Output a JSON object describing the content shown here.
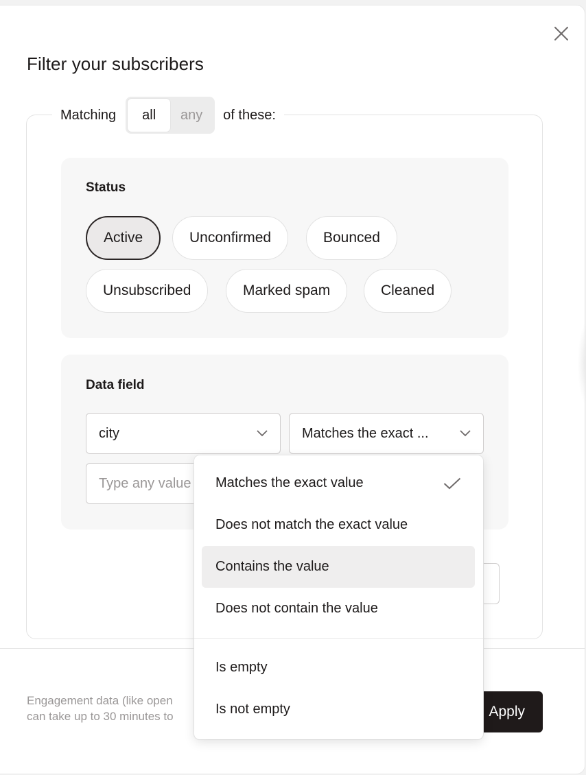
{
  "dialog": {
    "title": "Filter your subscribers",
    "close_icon": "close-icon"
  },
  "match": {
    "prefix": "Matching",
    "options": [
      "all",
      "any"
    ],
    "selected": "all",
    "suffix": "of these:"
  },
  "status": {
    "title": "Status",
    "chips": [
      "Active",
      "Unconfirmed",
      "Bounced",
      "Unsubscribed",
      "Marked spam",
      "Cleaned"
    ],
    "selected": "Active"
  },
  "data_field": {
    "title": "Data field",
    "field_value": "city",
    "operator_value": "Matches the exact ...",
    "value_placeholder": "Type any value"
  },
  "operator_menu": {
    "options": [
      "Matches the exact value",
      "Does not match the exact value",
      "Contains the value",
      "Does not contain the value",
      "Is empty",
      "Is not empty"
    ],
    "checked": "Matches the exact value",
    "hovered": "Contains the value"
  },
  "footer": {
    "note_line1": "Engagement data (like open",
    "note_line2": "can take up to 30 minutes to",
    "apply_label": "Apply"
  },
  "colors": {
    "accent_dark": "#1f1a1a",
    "panel_bg": "#f7f7f7",
    "muted_text": "#9a9797"
  }
}
